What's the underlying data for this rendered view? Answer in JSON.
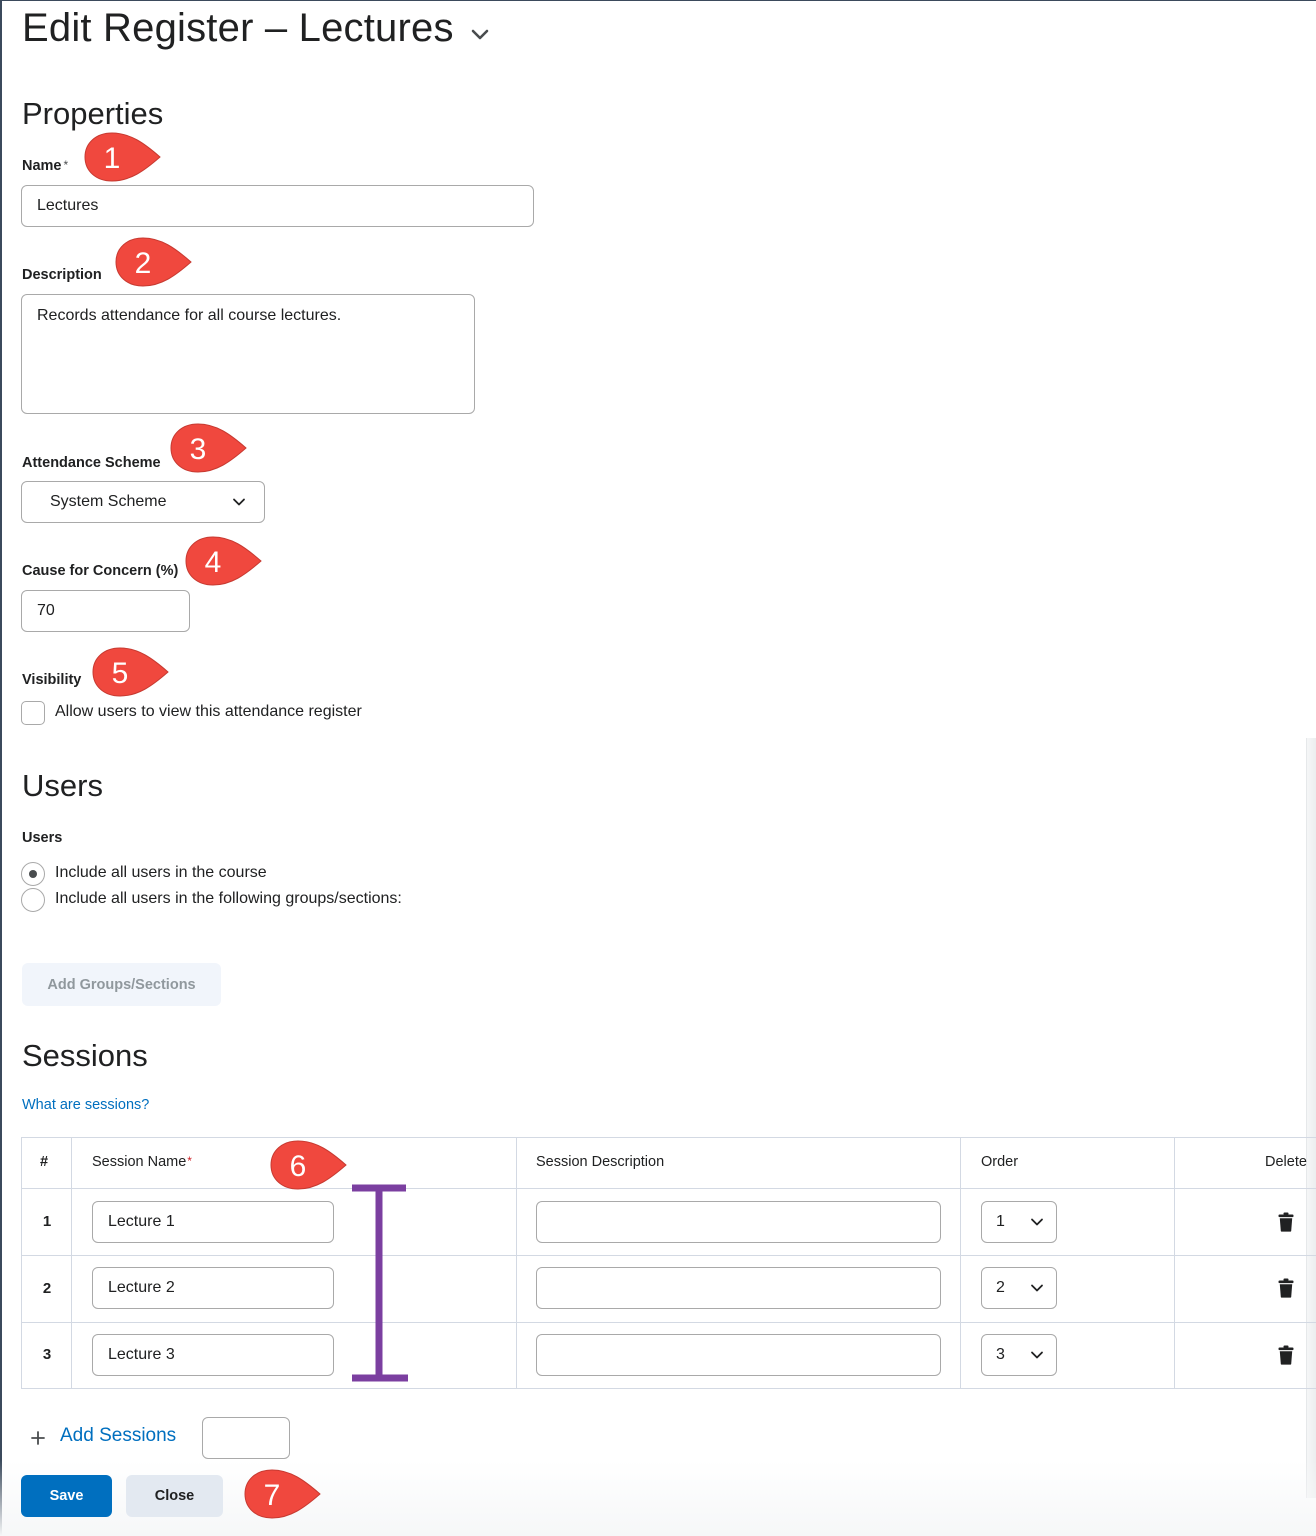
{
  "header": {
    "title": "Edit Register – Lectures"
  },
  "properties": {
    "heading": "Properties",
    "name_label": "Name",
    "name_required_mark": "*",
    "name_value": "Lectures",
    "description_label": "Description",
    "description_value": "Records attendance for all course lectures.",
    "scheme_label": "Attendance Scheme",
    "scheme_value": "System Scheme",
    "concern_label": "Cause for Concern (%)",
    "concern_value": "70",
    "visibility_label": "Visibility",
    "visibility_checkbox_label": "Allow users to view this attendance register",
    "visibility_checked": false
  },
  "users": {
    "heading": "Users",
    "label": "Users",
    "option_all": "Include all users in the course",
    "option_groups": "Include all users in the following groups/sections:",
    "selected": "all",
    "add_groups_button": "Add Groups/Sections"
  },
  "sessions": {
    "heading": "Sessions",
    "help_link": "What are sessions?",
    "columns": {
      "number": "#",
      "name": "Session Name",
      "name_required_mark": "*",
      "description": "Session Description",
      "order": "Order",
      "delete": "Delete"
    },
    "rows": [
      {
        "number": "1",
        "name": "Lecture 1",
        "description": "",
        "order": "1"
      },
      {
        "number": "2",
        "name": "Lecture 2",
        "description": "",
        "order": "2"
      },
      {
        "number": "3",
        "name": "Lecture 3",
        "description": "",
        "order": "3"
      }
    ],
    "add_sessions_link": "Add Sessions",
    "add_sessions_count": "",
    "add_icon": "plus-icon",
    "delete_icon": "trash-icon"
  },
  "footer": {
    "save_label": "Save",
    "close_label": "Close"
  },
  "annotations": {
    "callouts": [
      "1",
      "2",
      "3",
      "4",
      "5",
      "6",
      "7"
    ],
    "callout_color": "#f0483e",
    "bracket_color": "#7b3fa0"
  },
  "colors": {
    "primary": "#006fbf",
    "link": "#006fbf",
    "border": "#a9a9a9",
    "required": "#cd2026"
  }
}
